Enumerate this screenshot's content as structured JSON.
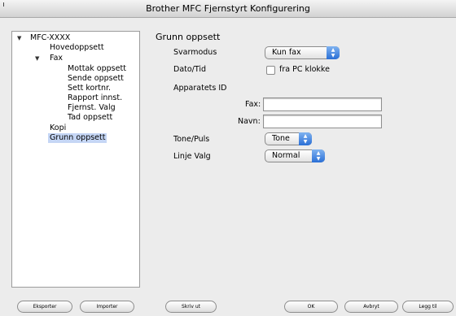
{
  "window": {
    "title": "Brother MFC Fjernstyrt Konfigurering"
  },
  "tree": {
    "root": "MFC-XXXX",
    "items": [
      {
        "label": "Hovedoppsett"
      },
      {
        "label": "Fax"
      },
      {
        "label": "Mottak oppsett"
      },
      {
        "label": "Sende oppsett"
      },
      {
        "label": "Sett kortnr."
      },
      {
        "label": "Rapport innst."
      },
      {
        "label": "Fjernst. Valg"
      },
      {
        "label": "Tad oppsett"
      },
      {
        "label": "Kopi"
      },
      {
        "label": "Grunn oppsett"
      }
    ],
    "selected": "Grunn oppsett"
  },
  "panel": {
    "heading": "Grunn oppsett",
    "svarmodus": {
      "label": "Svarmodus",
      "value": "Kun fax"
    },
    "datotid": {
      "label": "Dato/Tid",
      "checkbox_label": "fra PC klokke",
      "checked": false
    },
    "apparatets_id": {
      "label": "Apparatets ID",
      "fax_label": "Fax:",
      "fax_value": "",
      "navn_label": "Navn:",
      "navn_value": ""
    },
    "tonepuls": {
      "label": "Tone/Puls",
      "value": "Tone"
    },
    "linje_valg": {
      "label": "Linje Valg",
      "value": "Normal"
    }
  },
  "buttons": {
    "eksporter": "Eksporter",
    "importer": "Importer",
    "skriv_ut": "Skriv ut",
    "ok": "OK",
    "avbryt": "Avbryt",
    "legg_til": "Legg til"
  },
  "icons": {
    "tree_expanded": "disclosure-triangle-down-icon",
    "popup_arrows": "updown-arrows-icon"
  },
  "colors": {
    "selection": "#c5d6f5",
    "popup_accent": "#2a6fd6"
  }
}
